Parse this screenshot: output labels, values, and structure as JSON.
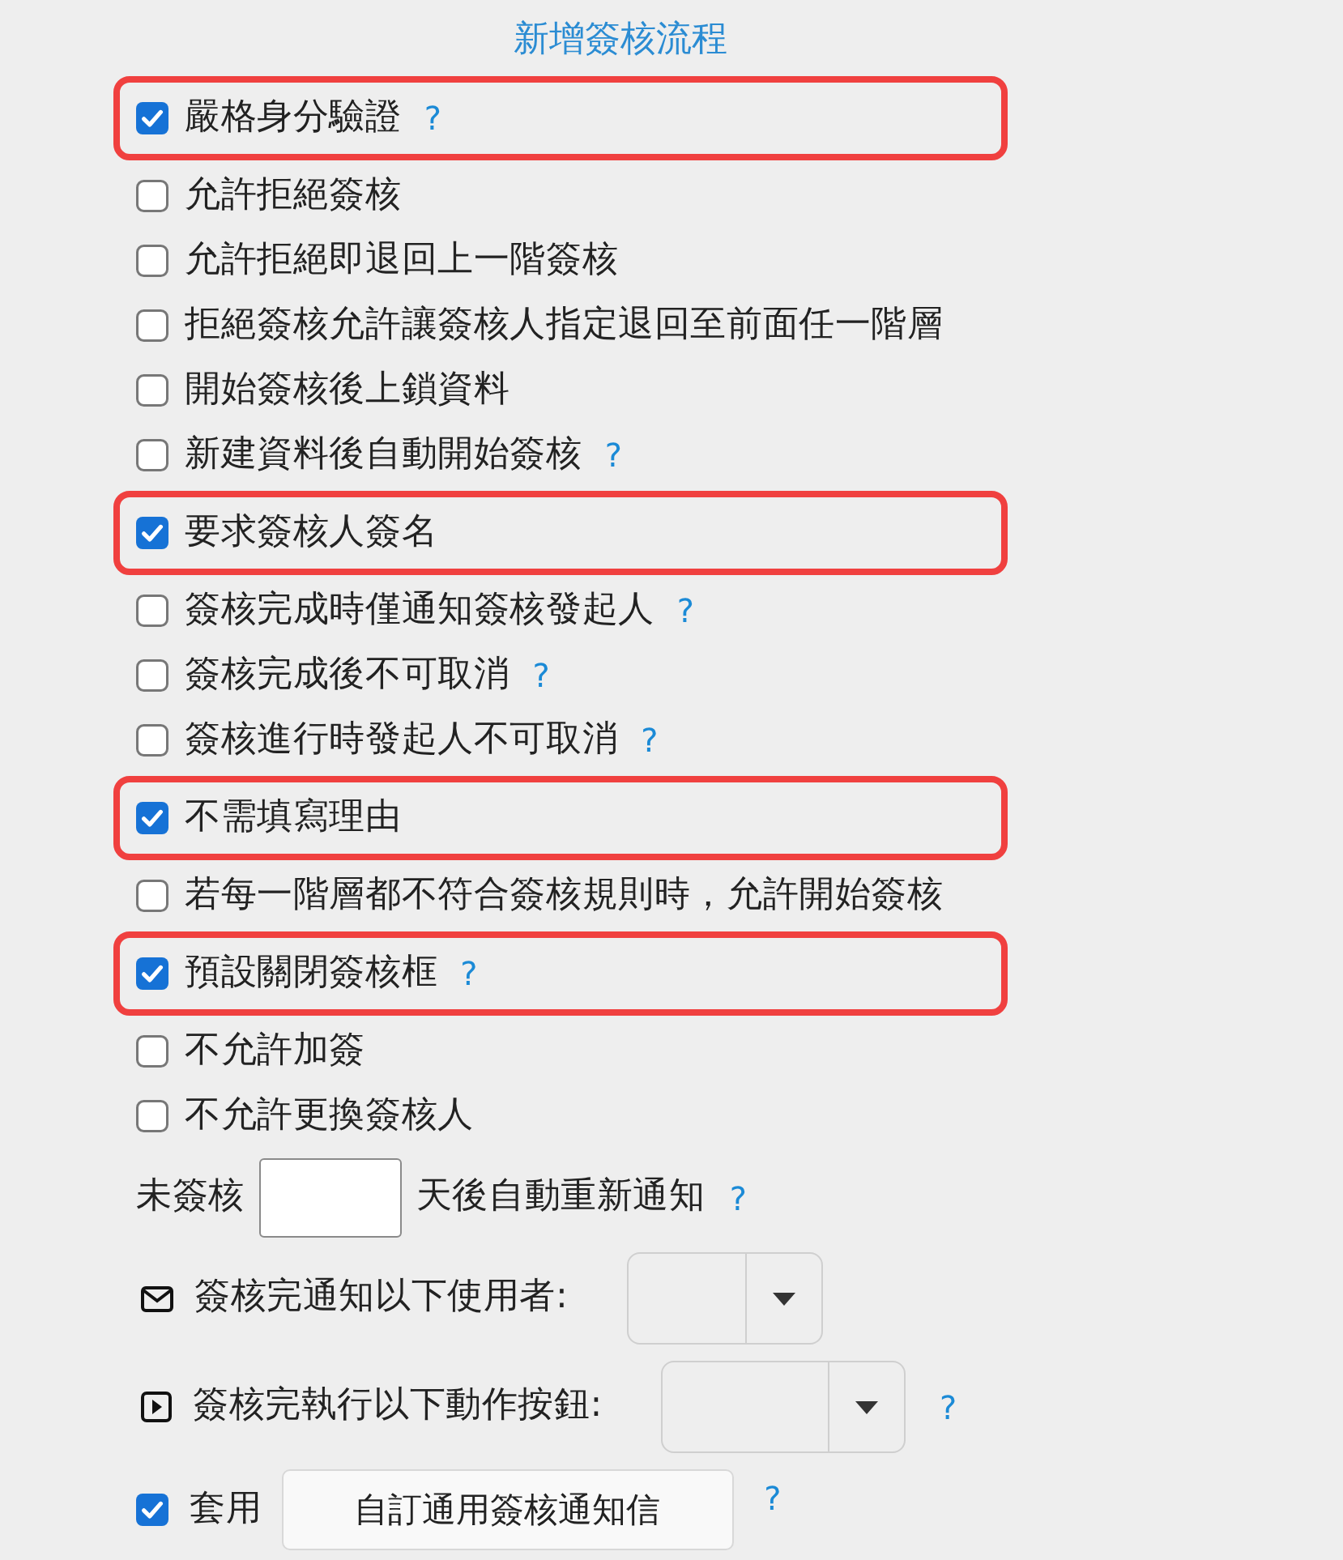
{
  "title": "新增簽核流程",
  "options": [
    {
      "label": "嚴格身分驗證",
      "checked": true,
      "highlighted": true,
      "help": "?"
    },
    {
      "label": "允許拒絕簽核",
      "checked": false,
      "highlighted": false
    },
    {
      "label": "允許拒絕即退回上一階簽核",
      "checked": false,
      "highlighted": false
    },
    {
      "label": "拒絕簽核允許讓簽核人指定退回至前面任一階層",
      "checked": false,
      "highlighted": false
    },
    {
      "label": "開始簽核後上鎖資料",
      "checked": false,
      "highlighted": false
    },
    {
      "label": "新建資料後自動開始簽核",
      "checked": false,
      "highlighted": false,
      "help": "?"
    },
    {
      "label": "要求簽核人簽名",
      "checked": true,
      "highlighted": true
    },
    {
      "label": "簽核完成時僅通知簽核發起人",
      "checked": false,
      "highlighted": false,
      "help": "?"
    },
    {
      "label": "簽核完成後不可取消",
      "checked": false,
      "highlighted": false,
      "help": "?"
    },
    {
      "label": "簽核進行時發起人不可取消",
      "checked": false,
      "highlighted": false,
      "help": "?"
    },
    {
      "label": "不需填寫理由",
      "checked": true,
      "highlighted": true
    },
    {
      "label": "若每一階層都不符合簽核規則時，允許開始簽核",
      "checked": false,
      "highlighted": false
    },
    {
      "label": "預設關閉簽核框",
      "checked": true,
      "highlighted": true,
      "help": "?"
    },
    {
      "label": "不允許加簽",
      "checked": false,
      "highlighted": false
    },
    {
      "label": "不允許更換簽核人",
      "checked": false,
      "highlighted": false
    }
  ],
  "reminder": {
    "prefix": "未簽核",
    "suffix": "天後自動重新通知",
    "help": "?"
  },
  "notify_users": {
    "label": "簽核完通知以下使用者:"
  },
  "run_action": {
    "label": "簽核完執行以下動作按鈕:",
    "help": "?"
  },
  "apply_template": {
    "checked": true,
    "label": "套用",
    "button": "自訂通用簽核通知信",
    "help": "?"
  }
}
